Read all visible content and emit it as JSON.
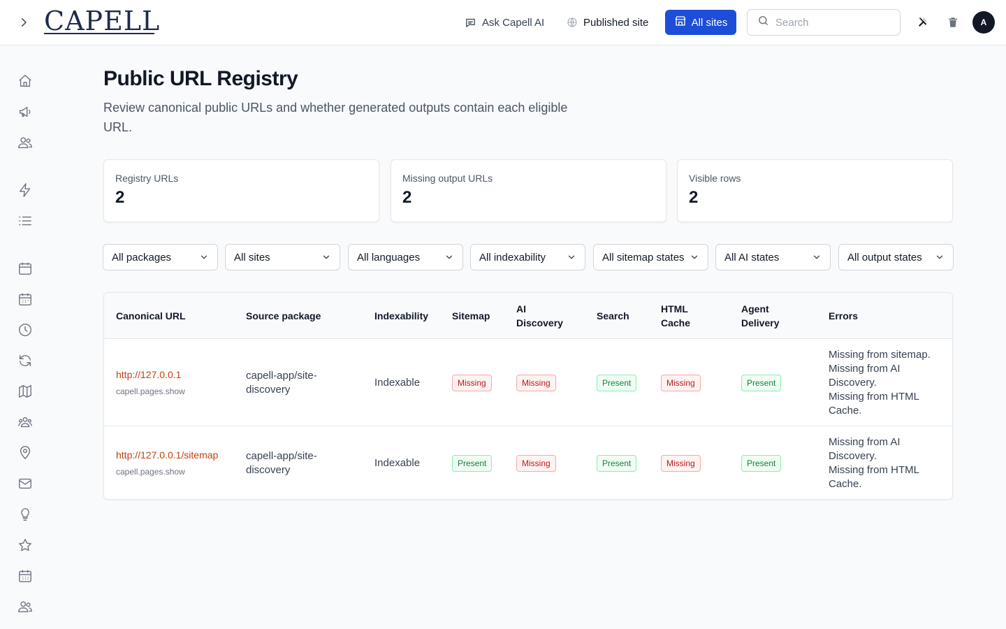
{
  "header": {
    "logo_text": "CAPELL",
    "ask_ai_label": "Ask Capell AI",
    "published_site_label": "Published site",
    "all_sites_label": "All sites",
    "search_placeholder": "Search",
    "avatar_initial": "A"
  },
  "sidebar": {
    "icons": [
      "home-icon",
      "megaphone-icon",
      "users-icon",
      "lightning-icon",
      "list-icon",
      "calendar-icon",
      "calendar-days-icon",
      "clock-icon",
      "refresh-icon",
      "map-icon",
      "user-group-icon",
      "map-pin-icon",
      "envelope-icon",
      "light-bulb-icon",
      "star-icon",
      "calendar-grid-icon",
      "users-2-icon"
    ]
  },
  "page": {
    "title": "Public URL Registry",
    "description": "Review canonical public URLs and whether generated outputs contain each eligible URL."
  },
  "stats": [
    {
      "label": "Registry URLs",
      "value": "2"
    },
    {
      "label": "Missing output URLs",
      "value": "2"
    },
    {
      "label": "Visible rows",
      "value": "2"
    }
  ],
  "filters": [
    "All packages",
    "All sites",
    "All languages",
    "All indexability",
    "All sitemap states",
    "All AI states",
    "All output states"
  ],
  "table": {
    "headers": [
      "Canonical URL",
      "Source package",
      "Indexability",
      "Sitemap",
      "AI Discovery",
      "Search",
      "HTML Cache",
      "Agent Delivery",
      "Errors"
    ],
    "rows": [
      {
        "url": "http://127.0.0.1",
        "route": "capell.pages.show",
        "package": "capell-app/site-discovery",
        "indexability": "Indexable",
        "sitemap": "Missing",
        "ai_discovery": "Missing",
        "search": "Present",
        "html_cache": "Missing",
        "agent_delivery": "Present",
        "errors": [
          "Missing from sitemap.",
          "Missing from AI Discovery.",
          "Missing from HTML Cache."
        ]
      },
      {
        "url": "http://127.0.0.1/sitemap",
        "route": "capell.pages.show",
        "package": "capell-app/site-discovery",
        "indexability": "Indexable",
        "sitemap": "Present",
        "ai_discovery": "Missing",
        "search": "Present",
        "html_cache": "Missing",
        "agent_delivery": "Present",
        "errors": [
          "Missing from AI Discovery.",
          "Missing from HTML Cache."
        ]
      }
    ]
  },
  "colors": {
    "accent": "#1d4ed8",
    "link": "#c2410c",
    "missing": "#b91c1c",
    "present": "#15803d"
  }
}
